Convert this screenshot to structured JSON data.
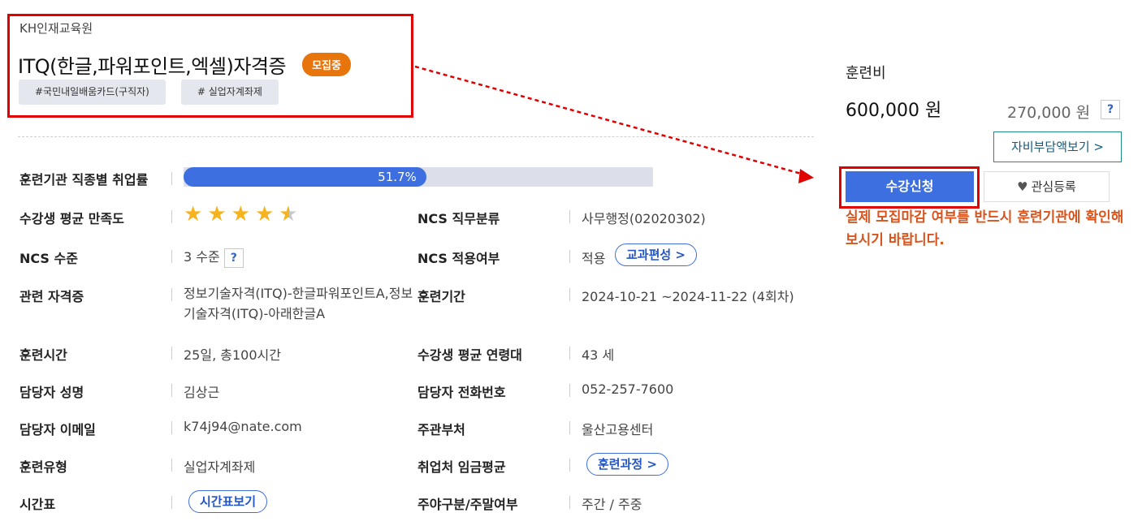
{
  "header": {
    "institution": "KH인재교육원",
    "course_title": "ITQ(한글,파워포인트,엑셀)자격증",
    "status_badge": "모집중",
    "tags": [
      "#국민내일배움카드(구직자)",
      "# 실업자계좌제"
    ]
  },
  "employment_rate": {
    "label": "훈련기관 직종별 취업률",
    "value_text": "51.7%",
    "fraction": 0.517
  },
  "details": {
    "satisfaction_label": "수강생 평균 만족도",
    "satisfaction_stars": 4.5,
    "ncs_category_label": "NCS 직무분류",
    "ncs_category_value": "사무행정(02020302)",
    "ncs_level_label": "NCS 수준",
    "ncs_level_value": "3 수준",
    "ncs_help": "?",
    "ncs_applied_label": "NCS 적용여부",
    "ncs_applied_value": "적용",
    "curriculum_button": "교과편성 >",
    "cert_label": "관련 자격증",
    "cert_value": "정보기술자격(ITQ)-한글파워포인트A,정보기술자격(ITQ)-아래한글A",
    "period_label": "훈련기간",
    "period_value": "2024-10-21 ~2024-11-22 (4회차)",
    "hours_label": "훈련시간",
    "hours_value": "25일, 총100시간",
    "age_label": "수강생 평균 연령대",
    "age_value": "43 세",
    "manager_label": "담당자 성명",
    "manager_value": "김상근",
    "phone_label": "담당자 전화번호",
    "phone_value": "052-257-7600",
    "email_label": "담당자 이메일",
    "email_value": "k74j94@nate.com",
    "dept_label": "주관부처",
    "dept_value": "울산고용센터",
    "type_label": "훈련유형",
    "type_value": "실업자계좌제",
    "wage_label": "취업처 임금평균",
    "course_button": "훈련과정 >",
    "schedule_label": "시간표",
    "schedule_button": "시간표보기",
    "daynight_label": "주야구분/주말여부",
    "daynight_value": "주간 / 주중"
  },
  "sidebar": {
    "fee_label": "훈련비",
    "fee_original": "600,000 원",
    "fee_self": "270,000 원",
    "fee_help": "?",
    "copay_button": "자비부담액보기 >",
    "apply_button": "수강신청",
    "like_button": "관심등록",
    "notice": "실제 모집마감 여부를 반드시 훈련기관에 확인해보시기 바랍니다."
  },
  "colors": {
    "accent": "#3d6fe0",
    "status_orange": "#e8740c",
    "annotation_red": "#e10000",
    "notice_orange": "#d9541c"
  }
}
